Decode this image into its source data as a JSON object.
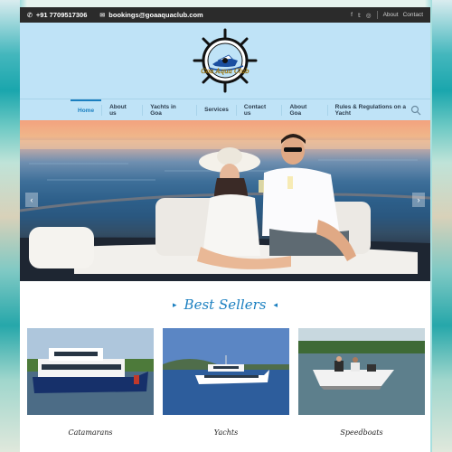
{
  "topbar": {
    "phone": "+91 7709517306",
    "email": "bookings@goaaquaclub.com",
    "social_icons": [
      "facebook-icon",
      "twitter-icon",
      "instagram-icon"
    ],
    "links": [
      "About",
      "Contact"
    ]
  },
  "brand": {
    "logo_text": "Goa Aqua Club"
  },
  "nav": {
    "items": [
      "Home",
      "About us",
      "Yachts in Goa",
      "Services",
      "Contact us",
      "About Goa",
      "Rules & Regulations on a Yacht"
    ],
    "active": "Home"
  },
  "slider": {
    "prev_label": "‹",
    "next_label": "›"
  },
  "bestsellers": {
    "title": "Best Sellers",
    "left_arrow": "▸",
    "right_arrow": "◂"
  },
  "cards": [
    {
      "label": "Catamarans"
    },
    {
      "label": "Yachts"
    },
    {
      "label": "Speedboats"
    }
  ],
  "colors": {
    "accent": "#1a7fc0",
    "header_bg": "#bfe3f7",
    "topbar_bg": "#2b2b2b"
  }
}
